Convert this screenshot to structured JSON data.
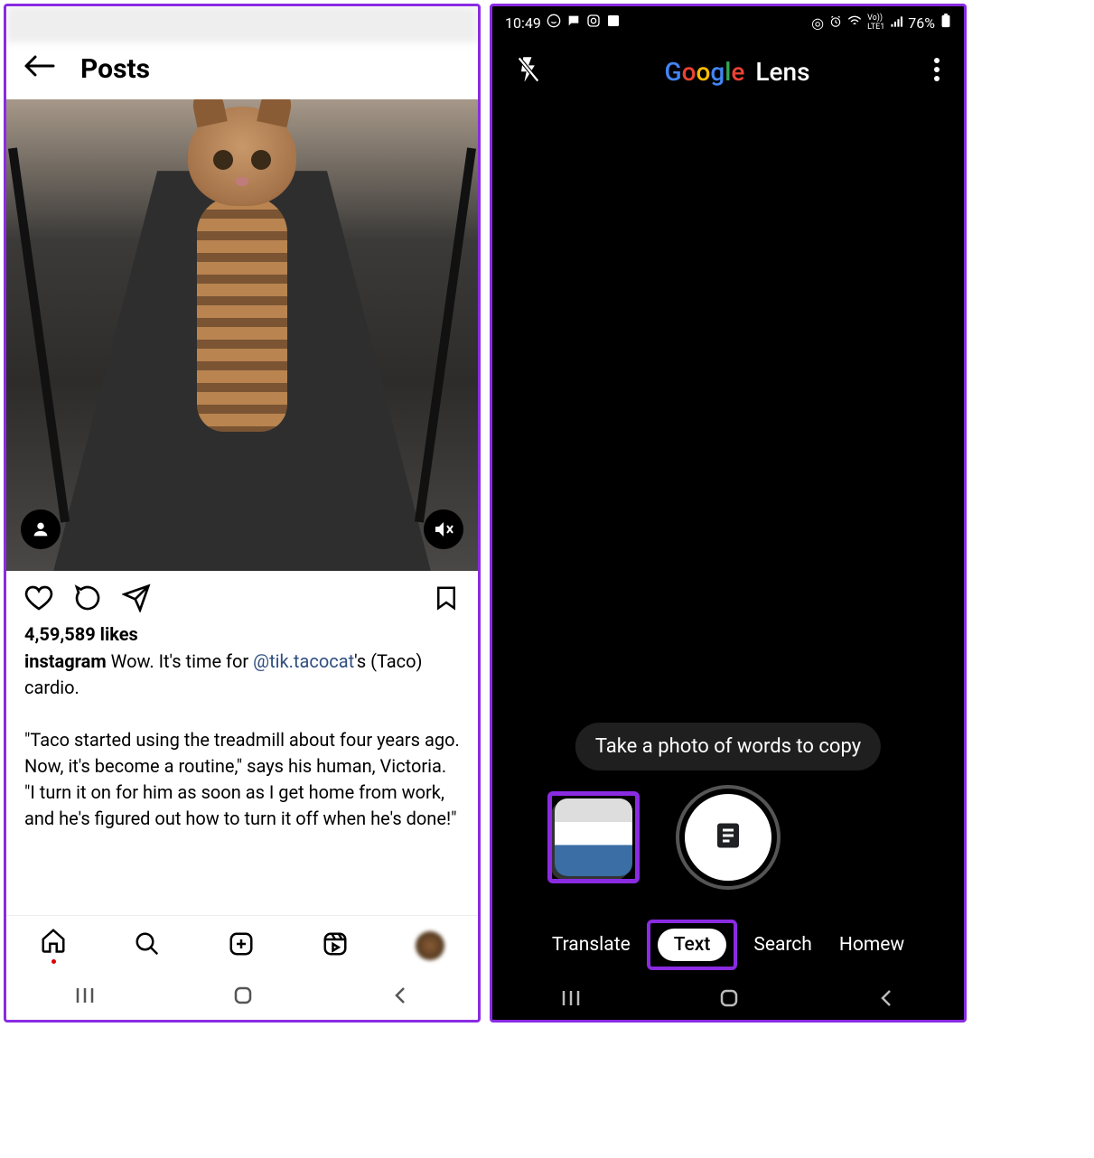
{
  "left": {
    "header_title": "Posts",
    "likes": "4,59,589 likes",
    "caption_user": "instagram",
    "caption_line1": " Wow. It's time for ",
    "caption_mention": "@tik.tacocat",
    "caption_line1_end": "'s (Taco) cardio.",
    "caption_para2": "\"Taco started using the treadmill about four years ago. Now, it's become a routine,\" says his human, Victoria. \"I turn it on for him as soon as I get home from work, and he's figured out how to turn it off when he's done!\"",
    "icons": {
      "back": "back-arrow-icon",
      "like": "heart-icon",
      "comment": "comment-icon",
      "share": "send-icon",
      "save": "bookmark-icon",
      "user_badge": "person-icon",
      "mute_badge": "mute-icon",
      "nav_home": "home-icon",
      "nav_search": "search-icon",
      "nav_add": "add-post-icon",
      "nav_reels": "reels-icon",
      "nav_profile": "profile-avatar"
    }
  },
  "right": {
    "status_time": "10:49",
    "status_battery": "76%",
    "status_net": "LTE1",
    "title_google": "Google",
    "title_lens": "Lens",
    "hint": "Take a photo of words to copy",
    "modes": {
      "translate": "Translate",
      "text": "Text",
      "search": "Search",
      "homework": "Homew"
    },
    "icons": {
      "flash_off": "flash-off-icon",
      "more": "more-vert-icon",
      "gallery": "gallery-thumbnail",
      "shutter": "shutter-button",
      "shutter_glyph": "text-document-icon"
    }
  },
  "sysnav": {
    "recents": "recents-icon",
    "home": "home-pill-icon",
    "back": "back-chevron-icon"
  }
}
